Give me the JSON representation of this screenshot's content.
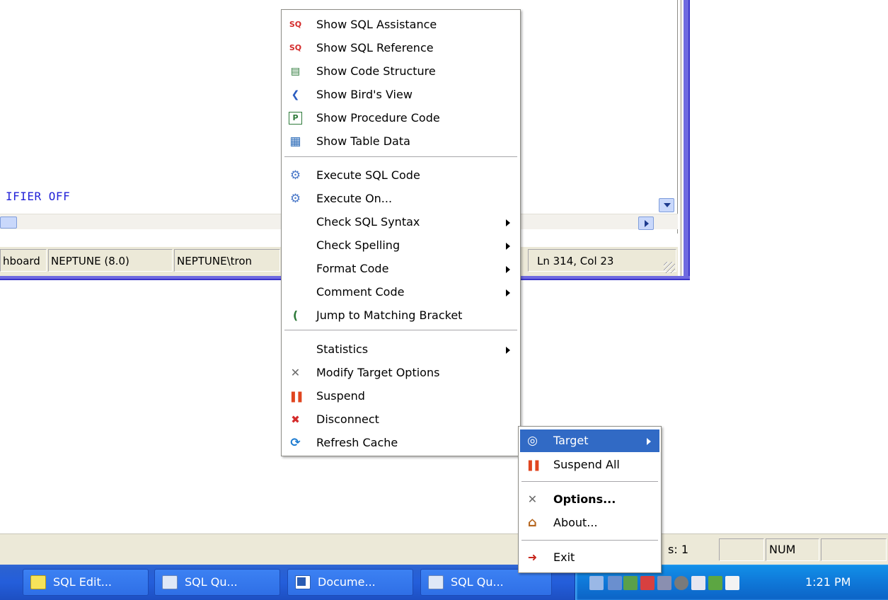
{
  "editor": {
    "code_line": "IFIER OFF",
    "status": {
      "cell1": "hboard",
      "server": "NEPTUNE (8.0)",
      "user": "NEPTUNE\\tron",
      "position": "Ln 314, Col 23"
    }
  },
  "context_menu": {
    "items": [
      {
        "label": "Show SQL Assistance",
        "icon": "sql-assistance-icon",
        "icon_glyph": "SQ"
      },
      {
        "label": "Show SQL Reference",
        "icon": "sql-reference-icon",
        "icon_glyph": "SQ"
      },
      {
        "label": "Show Code Structure",
        "icon": "code-structure-icon",
        "icon_glyph": "▤"
      },
      {
        "label": "Show Bird's View",
        "icon": "birds-view-icon",
        "icon_glyph": "❮"
      },
      {
        "label": "Show Procedure Code",
        "icon": "procedure-code-icon",
        "icon_glyph": "P"
      },
      {
        "label": "Show Table Data",
        "icon": "table-data-icon",
        "icon_glyph": "▦"
      },
      {
        "label": "Execute SQL Code",
        "icon": "gear-icon",
        "icon_glyph": "⚙"
      },
      {
        "label": "Execute On...",
        "icon": "gear-multi-icon",
        "icon_glyph": "⚙"
      },
      {
        "label": "Check SQL Syntax",
        "submenu": true
      },
      {
        "label": "Check Spelling",
        "submenu": true
      },
      {
        "label": "Format Code",
        "submenu": true
      },
      {
        "label": "Comment Code",
        "submenu": true
      },
      {
        "label": "Jump to Matching Bracket",
        "icon": "bracket-jump-icon",
        "icon_glyph": "("
      },
      {
        "label": "Statistics",
        "submenu": true
      },
      {
        "label": "Modify Target Options",
        "icon": "tools-icon",
        "icon_glyph": "✕"
      },
      {
        "label": "Suspend",
        "icon": "pause-icon",
        "icon_glyph": "❚❚"
      },
      {
        "label": "Disconnect",
        "icon": "disconnect-icon",
        "icon_glyph": "✖"
      },
      {
        "label": "Refresh Cache",
        "icon": "refresh-icon",
        "icon_glyph": "⟳"
      }
    ]
  },
  "tray_menu": {
    "items": [
      {
        "label": "Target",
        "icon": "target-icon",
        "icon_glyph": "◎",
        "submenu": true
      },
      {
        "label": "Suspend All",
        "icon": "pause-icon",
        "icon_glyph": "❚❚"
      },
      {
        "label": "Options...",
        "icon": "tools-icon",
        "icon_glyph": "✕"
      },
      {
        "label": "About...",
        "icon": "home-icon",
        "icon_glyph": "⌂"
      },
      {
        "label": "Exit",
        "icon": "exit-icon",
        "icon_glyph": "➜"
      }
    ]
  },
  "app_status": {
    "left_fragment": "s: 1",
    "num": "NUM"
  },
  "taskbar": {
    "buttons": [
      {
        "label": "SQL Edit...",
        "icon": "notepad-icon"
      },
      {
        "label": "SQL Qu...",
        "icon": "sql-query-icon"
      },
      {
        "label": "Docume...",
        "icon": "word-icon"
      },
      {
        "label": "SQL Qu...",
        "icon": "sql-query-icon"
      }
    ],
    "clock": "1:21 PM"
  },
  "colors": {
    "menu_highlight": "#316ac5",
    "taskbar_blue": "#245edb",
    "tray_blue": "#0f78d8",
    "code_blue": "#2323d8"
  }
}
